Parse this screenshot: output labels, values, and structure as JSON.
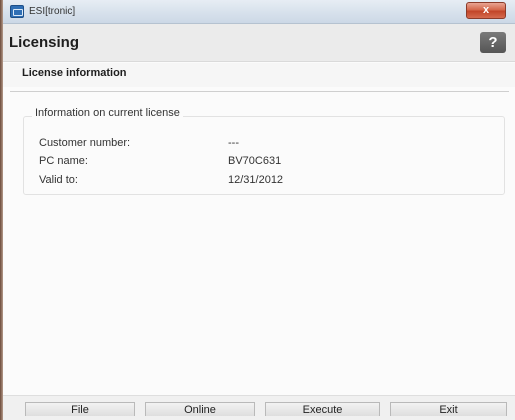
{
  "window": {
    "title": "ESI[tronic]",
    "close_label": "x"
  },
  "header": {
    "title": "Licensing",
    "help_label": "?"
  },
  "section": {
    "title": "License information"
  },
  "group": {
    "legend": "Information on current license",
    "rows": [
      {
        "label": "Customer number:",
        "value": "---"
      },
      {
        "label": "PC name:",
        "value": "BV70C631"
      },
      {
        "label": "Valid to:",
        "value": "12/31/2012"
      }
    ]
  },
  "buttons": {
    "file": "File",
    "online": "Online",
    "execute": "Execute",
    "exit": "Exit"
  },
  "colors": {
    "titlebar": "#d7e1ec",
    "close": "#c24528",
    "header_bg": "#ebebeb",
    "help_bg": "#666666"
  }
}
